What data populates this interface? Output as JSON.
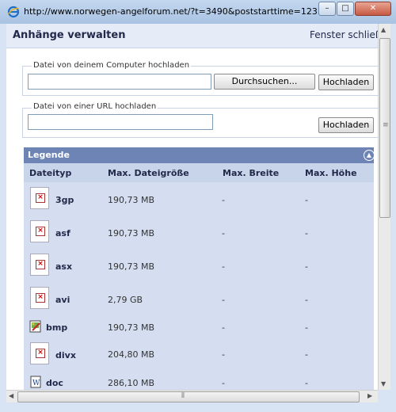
{
  "window": {
    "url": "http://www.norwegen-angelforum.net/?t=3490&poststarttime=123...",
    "minimize_label": "–",
    "maximize_label": "□",
    "close_label": "✕"
  },
  "header": {
    "title": "Anhänge verwalten",
    "link": "Fenster schließ"
  },
  "upload_computer": {
    "legend": "Datei von deinem Computer hochladen",
    "browse_label": "Durchsuchen...",
    "upload_label": "Hochladen"
  },
  "upload_url": {
    "legend": "Datei von einer URL hochladen",
    "upload_label": "Hochladen"
  },
  "legend": {
    "title": "Legende",
    "columns": [
      "Dateityp",
      "Max. Dateigröße",
      "Max. Breite",
      "Max. Höhe"
    ],
    "rows": [
      {
        "type": "3gp",
        "size": "190,73 MB",
        "width": "-",
        "height": "-"
      },
      {
        "type": "asf",
        "size": "190,73 MB",
        "width": "-",
        "height": "-"
      },
      {
        "type": "asx",
        "size": "190,73 MB",
        "width": "-",
        "height": "-"
      },
      {
        "type": "avi",
        "size": "2,79 GB",
        "width": "-",
        "height": "-"
      },
      {
        "type": "bmp",
        "size": "190,73 MB",
        "width": "-",
        "height": "-"
      },
      {
        "type": "divx",
        "size": "204,80 MB",
        "width": "-",
        "height": "-"
      },
      {
        "type": "doc",
        "size": "286,10 MB",
        "width": "-",
        "height": "-"
      }
    ]
  },
  "colors": {
    "legend_header": "#6d84b4",
    "column_header": "#c8d4ea",
    "table_body": "#d5def0",
    "page_header": "#e5ecf7"
  }
}
